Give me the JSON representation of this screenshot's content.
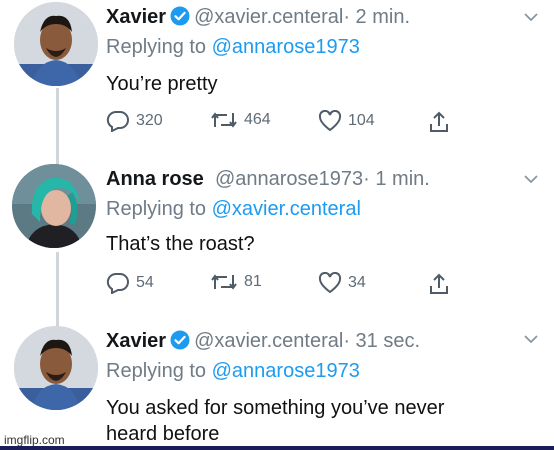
{
  "tweets": [
    {
      "name": "Xavier",
      "verified": true,
      "handle": "@xavier.centeral",
      "time": "· 2 min.",
      "replying_prefix": "Replying to ",
      "replying_to": "@annarose1973",
      "text": [
        "You’re pretty"
      ],
      "stats": {
        "replies": "320",
        "retweets": "464",
        "likes": "104"
      }
    },
    {
      "name": "Anna rose",
      "verified": false,
      "handle": "@annarose1973",
      "time": "· 1 min.",
      "replying_prefix": "Replying to ",
      "replying_to": "@xavier.centeral",
      "text": [
        "That’s the roast?"
      ],
      "stats": {
        "replies": "54",
        "retweets": "81",
        "likes": "34"
      }
    },
    {
      "name": "Xavier",
      "verified": true,
      "handle": "@xavier.centeral",
      "time": "· 31 sec.",
      "replying_prefix": "Replying to ",
      "replying_to": "@annarose1973",
      "text": [
        "You asked for something you’ve never",
        "heard before"
      ]
    }
  ],
  "watermark": "imgflip.com",
  "colors": {
    "accent": "#1d9bf0",
    "muted": "#6f7b86",
    "verified": "#1d9bf0"
  },
  "icons": [
    "reply-icon",
    "retweet-icon",
    "like-icon",
    "share-icon",
    "verified-badge-icon",
    "chevron-down-icon"
  ]
}
